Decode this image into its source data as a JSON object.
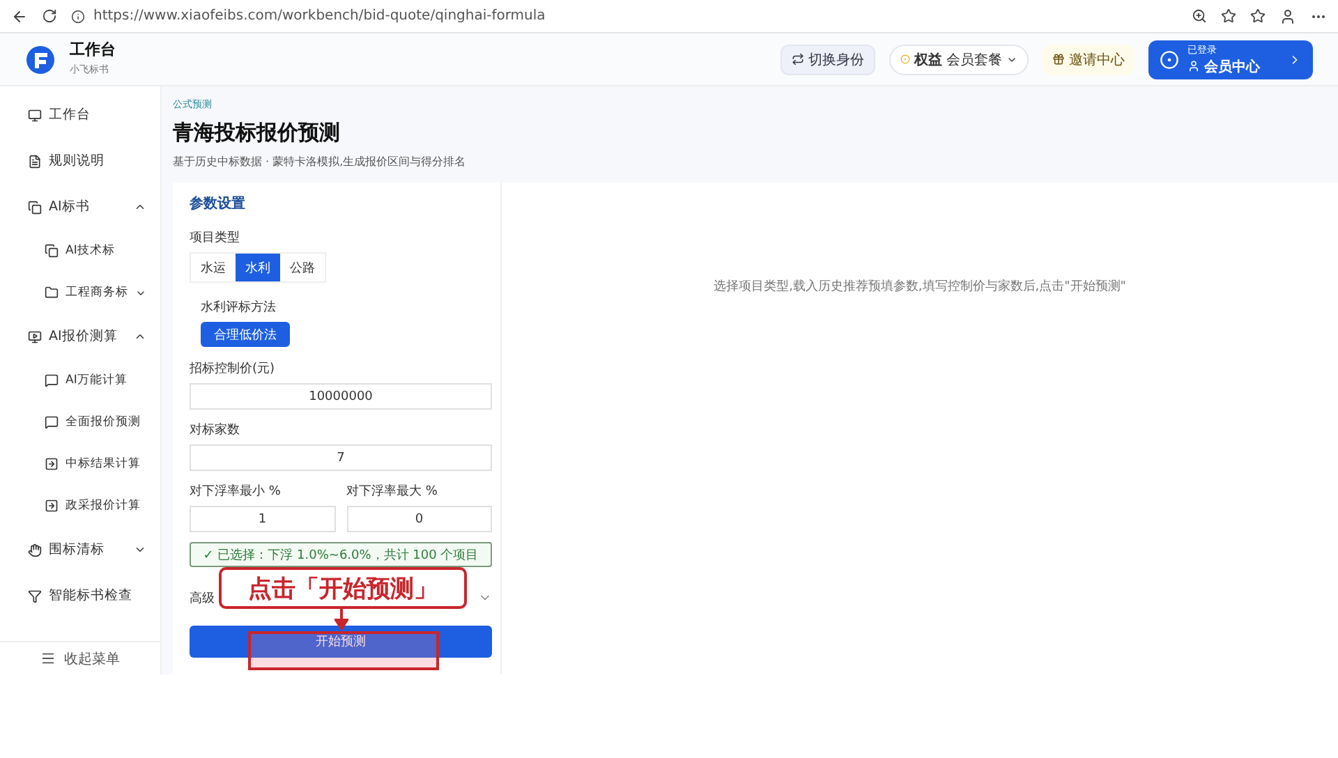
{
  "browser": {
    "url": "https://www.xiaofeibs.com/workbench/bid-quote/qinghai-formula"
  },
  "brand": {
    "title": "工作台",
    "subtitle": "小飞标书"
  },
  "header": {
    "switch_button": "切换身份",
    "benefit_label": "权益",
    "benefit_value": "会员套餐",
    "invite": "邀请中心",
    "member_caption": "已登录",
    "member_title": "会员中心"
  },
  "sidebar": {
    "items": [
      {
        "label": "工作台"
      },
      {
        "label": "规则说明"
      },
      {
        "label": "AI标书",
        "expanded": true,
        "children": [
          {
            "label": "AI技术标"
          },
          {
            "label": "工程商务标",
            "expanded": false
          }
        ]
      },
      {
        "label": "AI报价测算",
        "expanded": true,
        "children": [
          {
            "label": "AI万能计算"
          },
          {
            "label": "全面报价预测"
          },
          {
            "label": "中标结果计算"
          },
          {
            "label": "政采报价计算"
          }
        ]
      },
      {
        "label": "围标清标",
        "expanded": false
      },
      {
        "label": "智能标书检查"
      }
    ],
    "collapse": "收起菜单"
  },
  "page": {
    "breadcrumb": "公式预测",
    "title": "青海投标报价预测",
    "subtitle": "基于历史中标数据 · 蒙特卡洛模拟,生成报价区间与得分排名",
    "empty_hint": "选择项目类型,载入历史推荐预填参数,填写控制价与家数后,点击\"开始预测\""
  },
  "form": {
    "section": "参数设置",
    "type_label": "项目类型",
    "types": [
      {
        "label": "水运",
        "selected": false
      },
      {
        "label": "水利",
        "selected": true
      },
      {
        "label": "公路",
        "selected": false
      }
    ],
    "method_label": "水利评标方法",
    "method": "合理低价法",
    "fields": [
      {
        "label": "招标控制价(元)",
        "value": "10000000"
      },
      {
        "label": "对标家数",
        "value": "7"
      }
    ],
    "range": [
      {
        "label": "对下浮率最小 %",
        "value": "1"
      },
      {
        "label": "对下浮率最大 %",
        "value": "0"
      }
    ],
    "selection": "✓ 已选择：下浮 1.0%~6.0%，共计 100 个项目",
    "advanced": "高级",
    "advanced_expanded": false,
    "start": "开始预测"
  },
  "annotation": {
    "callout": "点击「开始预测」"
  }
}
